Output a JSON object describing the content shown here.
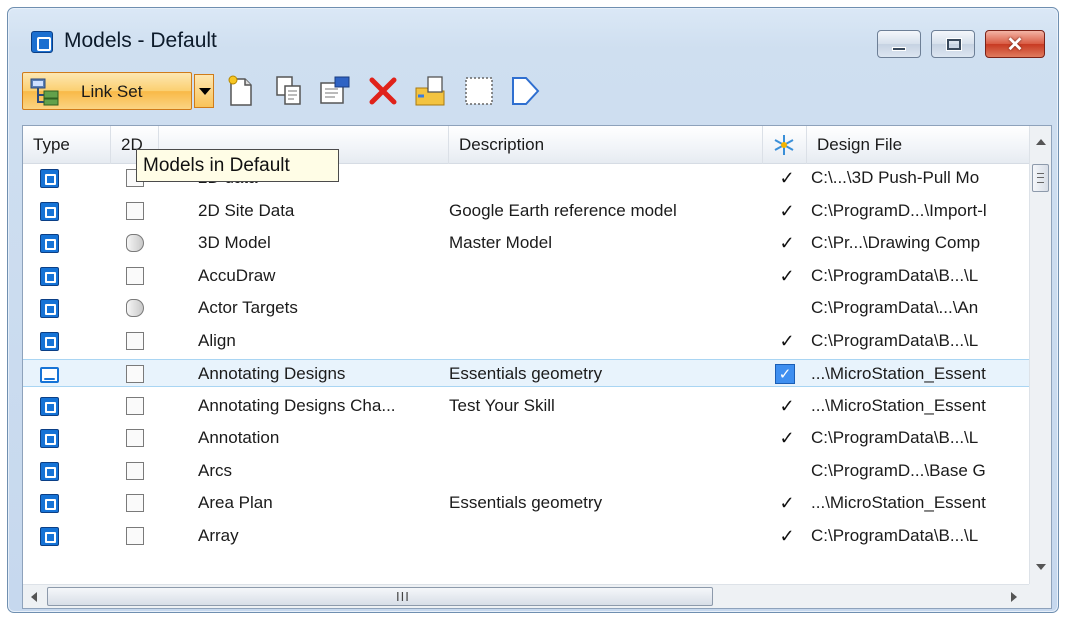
{
  "window": {
    "title": "Models - Default",
    "controls": {
      "minimize": "minimize",
      "maximize": "maximize",
      "close": "✕"
    }
  },
  "toolbar": {
    "link_set_label": "Link Set",
    "tools": [
      "new-model-icon",
      "copy-model-icon",
      "properties-icon",
      "delete-icon",
      "import-icon",
      "select-all-icon",
      "next-icon"
    ]
  },
  "tooltip": "Models in Default",
  "columns": {
    "type": "Type",
    "dim": "2D",
    "name": "",
    "description": "Description",
    "display": "snowflake-icon",
    "design_file": "Design File"
  },
  "rows": [
    {
      "type": "design",
      "dim": "2d",
      "name": "2D data",
      "description": "",
      "checked": "✓",
      "design_file": "C:\\...\\3D Push-Pull Mo"
    },
    {
      "type": "design",
      "dim": "2d",
      "name": "2D Site Data",
      "description": "Google Earth reference model",
      "checked": "✓",
      "design_file": "C:\\ProgramD...\\Import-l"
    },
    {
      "type": "design",
      "dim": "3d",
      "name": "3D Model",
      "description": "Master Model",
      "checked": "✓",
      "design_file": "C:\\Pr...\\Drawing Comp"
    },
    {
      "type": "design",
      "dim": "2d",
      "name": "AccuDraw",
      "description": "",
      "checked": "✓",
      "design_file": "C:\\ProgramData\\B...\\L"
    },
    {
      "type": "design",
      "dim": "3d",
      "name": "Actor Targets",
      "description": "",
      "checked": "",
      "design_file": "C:\\ProgramData\\...\\An"
    },
    {
      "type": "design",
      "dim": "2d",
      "name": "Align",
      "description": "",
      "checked": "✓",
      "design_file": "C:\\ProgramData\\B...\\L"
    },
    {
      "type": "sheet",
      "dim": "2d",
      "name": "Annotating Designs",
      "description": "Essentials geometry",
      "checked": "✓",
      "selected": true,
      "design_file": "...\\MicroStation_Essent"
    },
    {
      "type": "design",
      "dim": "2d",
      "name": "Annotating Designs Cha...",
      "description": "Test Your Skill",
      "checked": "✓",
      "design_file": "...\\MicroStation_Essent"
    },
    {
      "type": "design",
      "dim": "2d",
      "name": "Annotation",
      "description": "",
      "checked": "✓",
      "design_file": "C:\\ProgramData\\B...\\L"
    },
    {
      "type": "design",
      "dim": "2d",
      "name": "Arcs",
      "description": "",
      "checked": "",
      "design_file": "C:\\ProgramD...\\Base G"
    },
    {
      "type": "design",
      "dim": "2d",
      "name": "Area Plan",
      "description": "Essentials geometry",
      "checked": "✓",
      "design_file": "...\\MicroStation_Essent"
    },
    {
      "type": "design",
      "dim": "2d",
      "name": "Array",
      "description": "",
      "checked": "✓",
      "design_file": "C:\\ProgramData\\B...\\L"
    }
  ],
  "scrollbar": {
    "grip": "III"
  }
}
